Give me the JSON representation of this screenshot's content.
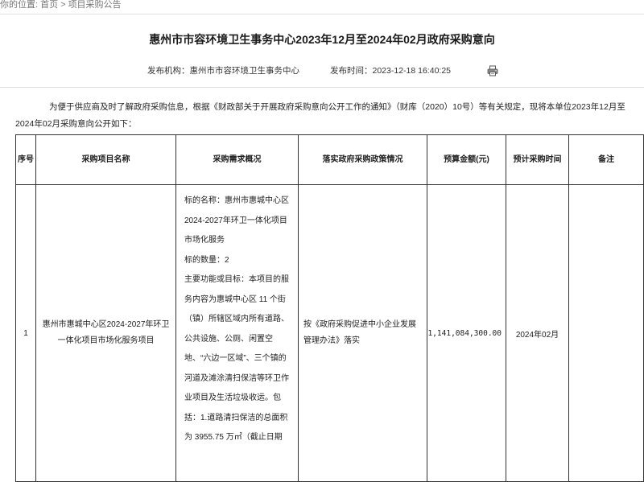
{
  "breadcrumb": {
    "prefix": "你的位置:",
    "home": "首页",
    "separator": ">",
    "current": "项目采购公告"
  },
  "article": {
    "title": "惠州市市容环境卫生事务中心2023年12月至2024年02月政府采购意向",
    "publisher": "发布机构：惠州市市容环境卫生事务中心",
    "publish_time": "发布时间：2023-12-18 16:40:25",
    "print_icon": "printer-icon",
    "intro": "为便于供应商及时了解政府采购信息，根据《财政部关于开展政府采购意向公开工作的通知》（财库（2020）10号）等有关规定，现将本单位2023年12月至2024年02月采购意向公开如下："
  },
  "table": {
    "headers": {
      "seq": "序号",
      "name": "采购项目名称",
      "requirement": "采购需求概况",
      "policy": "落实政府采购政策情况",
      "budget": "预算金额(元)",
      "time": "预计采购时间",
      "remark": "备注"
    },
    "rows": [
      {
        "seq": "1",
        "name": "惠州市惠城中心区2024-2027年环卫一体化项目市场化服务项目",
        "requirement_lines": [
          "标的名称：惠州市惠城中心区2024-2027年环卫一体化项目市场化服务",
          "标的数量：2",
          "主要功能或目标：本项目的服务内容为惠城中心区 11 个街（镇）所辖区域内所有道路、公共设施、公厕、闲置空地、“六边一区域”、三个镇的河道及滩涂清扫保洁等环卫作业项目及生活垃圾收运。包括：1.道路清扫保洁的总面积为 3955.75 万㎡（截止日期"
        ],
        "policy": "按《政府采购促进中小企业发展管理办法》落实",
        "budget": "1,141,084,300.00",
        "time": "2024年02月",
        "remark": ""
      }
    ]
  }
}
